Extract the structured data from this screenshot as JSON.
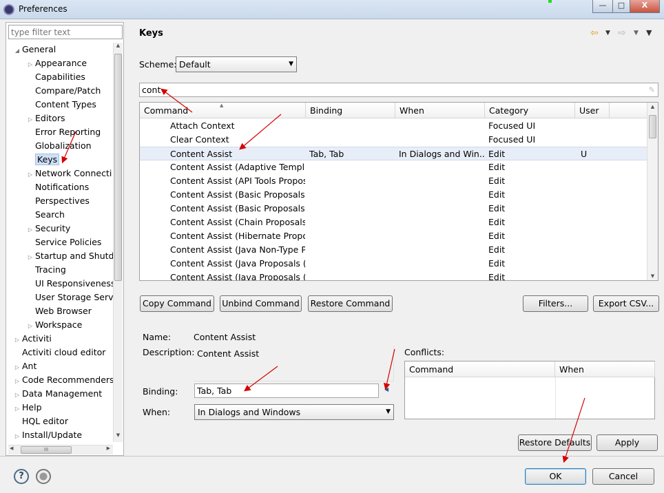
{
  "window": {
    "title": "Preferences",
    "minimize": "—",
    "maximize": "□",
    "close": "X"
  },
  "left": {
    "filter_placeholder": "type filter text",
    "tree": [
      {
        "label": "General",
        "level": 0,
        "arrow": "open"
      },
      {
        "label": "Appearance",
        "level": 1,
        "arrow": "closed"
      },
      {
        "label": "Capabilities",
        "level": 1,
        "arrow": "none"
      },
      {
        "label": "Compare/Patch",
        "level": 1,
        "arrow": "none"
      },
      {
        "label": "Content Types",
        "level": 1,
        "arrow": "none"
      },
      {
        "label": "Editors",
        "level": 1,
        "arrow": "closed"
      },
      {
        "label": "Error Reporting",
        "level": 1,
        "arrow": "none"
      },
      {
        "label": "Globalization",
        "level": 1,
        "arrow": "none"
      },
      {
        "label": "Keys",
        "level": 1,
        "arrow": "none",
        "selected": true
      },
      {
        "label": "Network Connecti",
        "level": 1,
        "arrow": "closed"
      },
      {
        "label": "Notifications",
        "level": 1,
        "arrow": "none"
      },
      {
        "label": "Perspectives",
        "level": 1,
        "arrow": "none"
      },
      {
        "label": "Search",
        "level": 1,
        "arrow": "none"
      },
      {
        "label": "Security",
        "level": 1,
        "arrow": "closed"
      },
      {
        "label": "Service Policies",
        "level": 1,
        "arrow": "none"
      },
      {
        "label": "Startup and Shutd",
        "level": 1,
        "arrow": "closed"
      },
      {
        "label": "Tracing",
        "level": 1,
        "arrow": "none"
      },
      {
        "label": "UI Responsiveness",
        "level": 1,
        "arrow": "none"
      },
      {
        "label": "User Storage Serv",
        "level": 1,
        "arrow": "none"
      },
      {
        "label": "Web Browser",
        "level": 1,
        "arrow": "none"
      },
      {
        "label": "Workspace",
        "level": 1,
        "arrow": "closed"
      },
      {
        "label": "Activiti",
        "level": 0,
        "arrow": "closed"
      },
      {
        "label": "Activiti cloud editor",
        "level": 0,
        "arrow": "none"
      },
      {
        "label": "Ant",
        "level": 0,
        "arrow": "closed"
      },
      {
        "label": "Code Recommenders",
        "level": 0,
        "arrow": "closed"
      },
      {
        "label": "Data Management",
        "level": 0,
        "arrow": "closed"
      },
      {
        "label": "Help",
        "level": 0,
        "arrow": "closed"
      },
      {
        "label": "HQL editor",
        "level": 0,
        "arrow": "none"
      },
      {
        "label": "Install/Update",
        "level": 0,
        "arrow": "closed"
      }
    ],
    "hscroll_thumb": "III"
  },
  "page": {
    "title": "Keys",
    "scheme_label": "Scheme:",
    "scheme_value": "Default",
    "filter_value": "cont"
  },
  "table": {
    "headers": [
      "Command",
      "Binding",
      "When",
      "Category",
      "User"
    ],
    "rows": [
      {
        "command": "Attach Context",
        "binding": "",
        "when": "",
        "category": "Focused UI",
        "user": ""
      },
      {
        "command": "Clear Context",
        "binding": "",
        "when": "",
        "category": "Focused UI",
        "user": ""
      },
      {
        "command": "Content Assist",
        "binding": "Tab, Tab",
        "when": "In Dialogs and Win...",
        "category": "Edit",
        "user": "U",
        "selected": true
      },
      {
        "command": "Content Assist (Adaptive Template",
        "binding": "",
        "when": "",
        "category": "Edit",
        "user": ""
      },
      {
        "command": "Content Assist (API Tools Proposa",
        "binding": "",
        "when": "",
        "category": "Edit",
        "user": ""
      },
      {
        "command": "Content Assist (Basic Proposals)",
        "binding": "",
        "when": "",
        "category": "Edit",
        "user": ""
      },
      {
        "command": "Content Assist (Basic Proposals)",
        "binding": "",
        "when": "",
        "category": "Edit",
        "user": ""
      },
      {
        "command": "Content Assist (Chain Proposals (C",
        "binding": "",
        "when": "",
        "category": "Edit",
        "user": ""
      },
      {
        "command": "Content Assist (Hibernate Proposa",
        "binding": "",
        "when": "",
        "category": "Edit",
        "user": ""
      },
      {
        "command": "Content Assist (Java Non-Type Pro",
        "binding": "",
        "when": "",
        "category": "Edit",
        "user": ""
      },
      {
        "command": "Content Assist (Java Proposals (Co",
        "binding": "",
        "when": "",
        "category": "Edit",
        "user": ""
      },
      {
        "command": "Content Assist (Java Proposals (Ta",
        "binding": "",
        "when": "",
        "category": "Edit",
        "user": ""
      }
    ]
  },
  "buttons": {
    "copy": "Copy Command",
    "unbind": "Unbind Command",
    "restore": "Restore Command",
    "filters": "Filters...",
    "export": "Export CSV...",
    "restore_defaults": "Restore Defaults",
    "apply": "Apply",
    "ok": "OK",
    "cancel": "Cancel"
  },
  "details": {
    "name_label": "Name:",
    "name_value": "Content Assist",
    "description_label": "Description:",
    "description_value": "Content Assist",
    "binding_label": "Binding:",
    "binding_value": "Tab, Tab",
    "when_label": "When:",
    "when_value": "In Dialogs and Windows",
    "conflicts_label": "Conflicts:",
    "conflicts_headers": [
      "Command",
      "When"
    ]
  },
  "help_glyph": "?",
  "colors": {
    "annotation_arrow": "#d40000",
    "selection": "#cde0f7"
  }
}
